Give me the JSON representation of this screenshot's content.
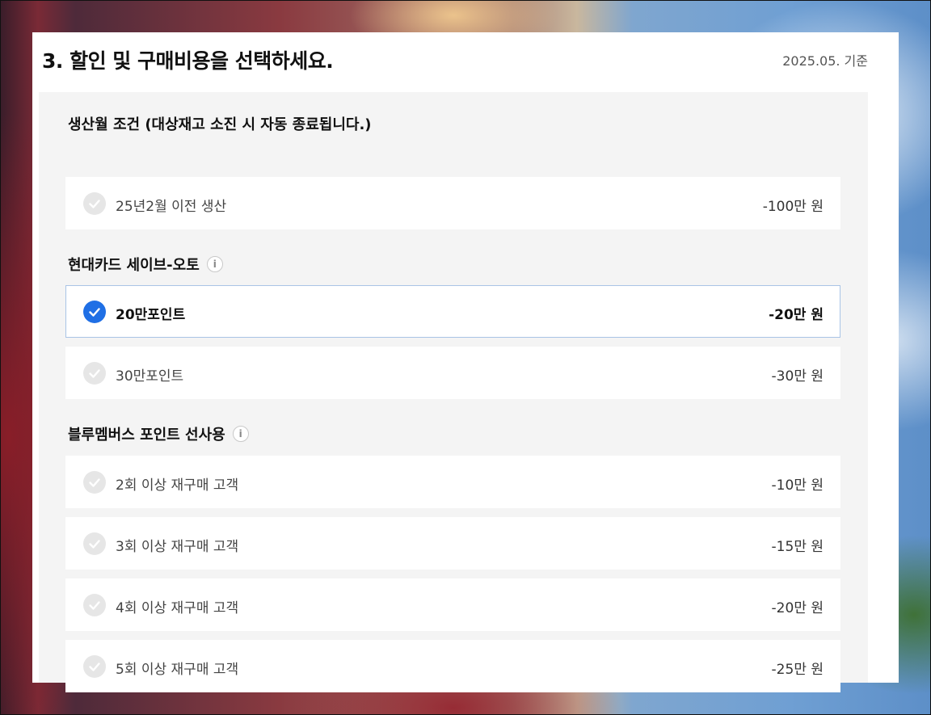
{
  "header": {
    "title": "3. 할인 및 구매비용을 선택하세요.",
    "as_of": "2025.05. 기준"
  },
  "sections": [
    {
      "title": "생산월 조건 (대상재고 소진 시 자동 종료됩니다.)",
      "has_info_icon": false,
      "options": [
        {
          "label": "25년2월 이전 생산",
          "amount": "-100만 원",
          "selected": false
        }
      ]
    },
    {
      "title": "현대카드 세이브-오토",
      "has_info_icon": true,
      "options": [
        {
          "label": "20만포인트",
          "amount": "-20만 원",
          "selected": true
        },
        {
          "label": "30만포인트",
          "amount": "-30만 원",
          "selected": false
        }
      ]
    },
    {
      "title": "블루멤버스 포인트 선사용",
      "has_info_icon": true,
      "options": [
        {
          "label": "2회 이상 재구매 고객",
          "amount": "-10만 원",
          "selected": false
        },
        {
          "label": "3회 이상 재구매 고객",
          "amount": "-15만 원",
          "selected": false
        },
        {
          "label": "4회 이상 재구매 고객",
          "amount": "-20만 원",
          "selected": false
        },
        {
          "label": "5회 이상 재구매 고객",
          "amount": "-25만 원",
          "selected": false
        }
      ]
    }
  ],
  "icons": {
    "info": "i",
    "check": "check-icon"
  },
  "colors": {
    "selected_accent": "#1f6fe5",
    "selected_border": "#a9c4e6",
    "unselected_check": "#e6e6e6",
    "panel_background": "#f4f4f4"
  }
}
